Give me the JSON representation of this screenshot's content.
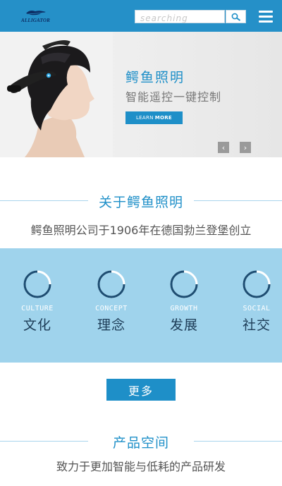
{
  "header": {
    "logo_text": "ALLIGATOR",
    "search_placeholder": "searching",
    "menu_icon": "hamburger-icon",
    "search_icon": "search-icon",
    "brand_color": "#2590c8"
  },
  "banner": {
    "title": "鳄鱼照明",
    "subtitle": "智能遥控一键控制",
    "learn_button": {
      "prefix": "LEARN",
      "bold": "MORE"
    },
    "prev_symbol": "‹",
    "next_symbol": "›"
  },
  "about": {
    "title": "关于鳄鱼照明",
    "description": "鳄鱼照明公司于1906年在德国勃兰登堡创立"
  },
  "features": [
    {
      "en": "CULTURE",
      "cn": "文化"
    },
    {
      "en": "CONCEPT",
      "cn": "理念"
    },
    {
      "en": "GROWTH",
      "cn": "发展"
    },
    {
      "en": "SOCIAL",
      "cn": "社交"
    }
  ],
  "more_button": "更多",
  "products": {
    "title": "产品空间",
    "description": "致力于更加智能与低耗的产品研发"
  },
  "colors": {
    "accent": "#1e8fc8",
    "band": "#9fd3ec",
    "ring_dark": "#1d4d72",
    "ring_light": "#ffffff"
  }
}
